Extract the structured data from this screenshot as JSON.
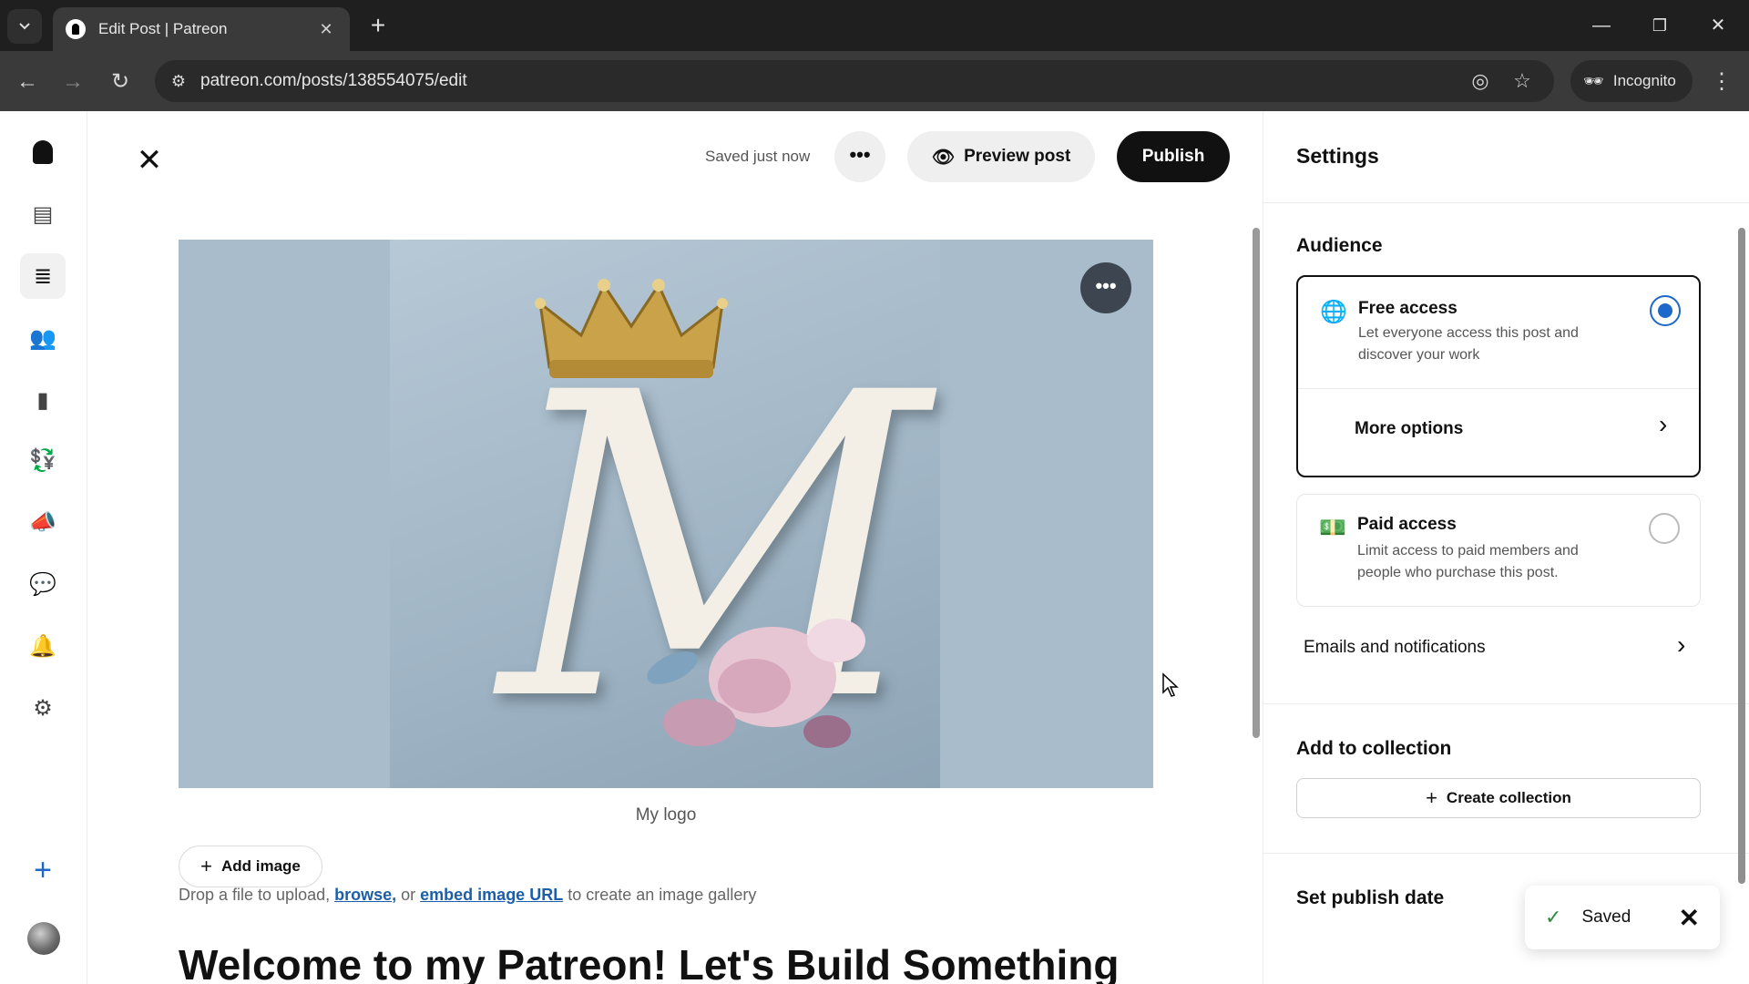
{
  "browser": {
    "tab_title": "Edit Post | Patreon",
    "tab_close": "✕",
    "new_tab": "+",
    "url": "patreon.com/posts/138554075/edit",
    "incognito_label": "Incognito",
    "window_controls": {
      "minimize": "—",
      "restore": "❐",
      "close": "✕"
    }
  },
  "rail": {
    "items": [
      "patreon-logo",
      "dashboard-icon",
      "posts-icon",
      "audience-icon",
      "insights-icon",
      "payouts-icon",
      "promotions-icon",
      "chats-icon",
      "notifications-icon",
      "settings-icon"
    ],
    "create_label": "+"
  },
  "editor": {
    "close_label": "✕",
    "save_status": "Saved just now",
    "more_label": "•••",
    "preview_label": "Preview post",
    "publish_label": "Publish",
    "image_more_label": "•••",
    "image_caption": "My logo",
    "add_image_label": "Add image",
    "drop_text": {
      "prefix": "Drop a file to upload, ",
      "browse": "browse,",
      "middle": " or ",
      "embed": "embed image URL",
      "suffix": " to create an image gallery"
    },
    "post_title": "Welcome to my Patreon! Let's Build Something"
  },
  "settings": {
    "title": "Settings",
    "audience": {
      "heading": "Audience",
      "free": {
        "title": "Free access",
        "desc": "Let everyone access this post and discover your work",
        "selected": true
      },
      "more_options": "More options",
      "paid": {
        "title": "Paid access",
        "desc": "Limit access to paid members and people who purchase this post.",
        "selected": false
      }
    },
    "emails_label": "Emails and notifications",
    "collection": {
      "heading": "Add to collection",
      "create_label": "Create collection"
    },
    "publish_date_heading": "Set publish date"
  },
  "toast": {
    "message": "Saved",
    "close": "✕"
  },
  "colors": {
    "accent_blue": "#1d68c9",
    "publish_bg": "#111111",
    "link": "#1c5fa8"
  }
}
